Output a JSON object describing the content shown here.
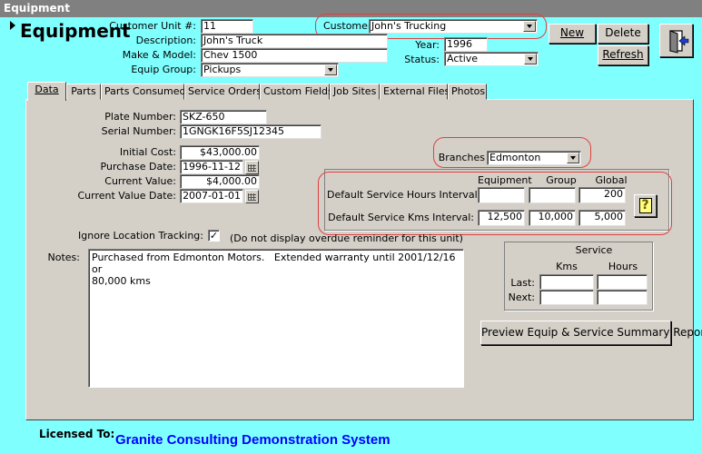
{
  "window": {
    "title": "Equipment"
  },
  "header": {
    "title": "Equipment",
    "customer_unit_label": "Customer Unit #:",
    "customer_unit_value": "11",
    "customer_label": "Customer:",
    "customer_value": "John's Trucking",
    "description_label": "Description:",
    "description_value": "John's Truck",
    "make_model_label": "Make & Model:",
    "make_model_value": "Chev  1500",
    "equip_group_label": "Equip Group:",
    "equip_group_value": "Pickups",
    "year_label": "Year:",
    "year_value": "1996",
    "status_label": "Status:",
    "status_value": "Active"
  },
  "toolbar": {
    "new_label": "New",
    "delete_label": "Delete",
    "refresh_label": "Refresh",
    "exit_icon": "exit-door-icon"
  },
  "tabs": [
    {
      "label": "Data",
      "active": true
    },
    {
      "label": "Parts"
    },
    {
      "label": "Parts Consumed"
    },
    {
      "label": "Service Orders"
    },
    {
      "label": "Custom Fields"
    },
    {
      "label": "Job Sites"
    },
    {
      "label": "External Files"
    },
    {
      "label": "Photos"
    }
  ],
  "data_tab": {
    "plate_label": "Plate Number:",
    "plate_value": "SKZ-650",
    "serial_label": "Serial Number:",
    "serial_value": "1GNGK16F5SJ12345",
    "initial_cost_label": "Initial Cost:",
    "initial_cost_value": "$43,000.00",
    "purchase_date_label": "Purchase Date:",
    "purchase_date_value": "1996-11-12",
    "current_value_label": "Current Value:",
    "current_value_value": "$4,000.00",
    "current_value_date_label": "Current Value Date:",
    "current_value_date_value": "2007-01-01",
    "branches_label": "Branches",
    "branches_value": "Edmonton",
    "interval": {
      "col_equipment": "Equipment",
      "col_group": "Group",
      "col_global": "Global",
      "hours_label": "Default Service Hours Interval:",
      "hours_equipment": "",
      "hours_group": "",
      "hours_global": "200",
      "kms_label": "Default Service Kms Interval:",
      "kms_equipment": "12,500",
      "kms_group": "10,000",
      "kms_global": "5,000",
      "help_glyph": "?"
    },
    "ignore_tracking_label": "Ignore Location Tracking:",
    "ignore_tracking_checked": "✓",
    "ignore_tracking_note": "(Do not display overdue reminder for this unit)",
    "notes_label": "Notes:",
    "notes_value": "Purchased from Edmonton Motors.   Extended warranty until 2001/12/16 or\n80,000 kms",
    "service": {
      "title": "Service",
      "col_kms": "Kms",
      "col_hours": "Hours",
      "last_label": "Last:",
      "next_label": "Next:"
    },
    "preview_button_label": "Preview Equip & Service Summary Report"
  },
  "footer": {
    "licensed_label": "Licensed To:",
    "licensed_value": "Granite Consulting Demonstration System"
  }
}
